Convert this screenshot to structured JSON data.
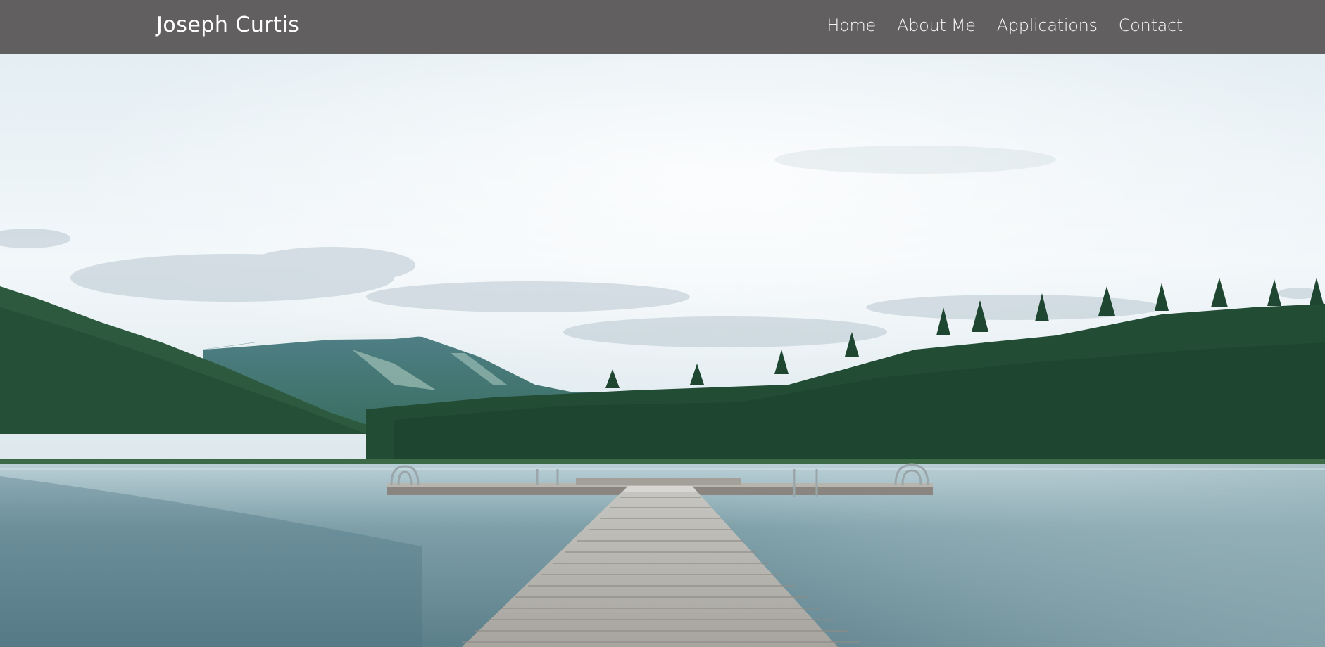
{
  "header": {
    "brand": "Joseph Curtis",
    "nav": [
      {
        "label": "Home"
      },
      {
        "label": "About Me"
      },
      {
        "label": "Applications"
      },
      {
        "label": "Contact"
      }
    ]
  },
  "hero": {
    "image_icon": "lake-dock-landscape-photo"
  },
  "colors": {
    "navbar": "#615f5f",
    "nav_text": "#ffffff",
    "sky": "#eef4f8",
    "forest": "#1f4d33",
    "water": "#7fa3ad"
  }
}
